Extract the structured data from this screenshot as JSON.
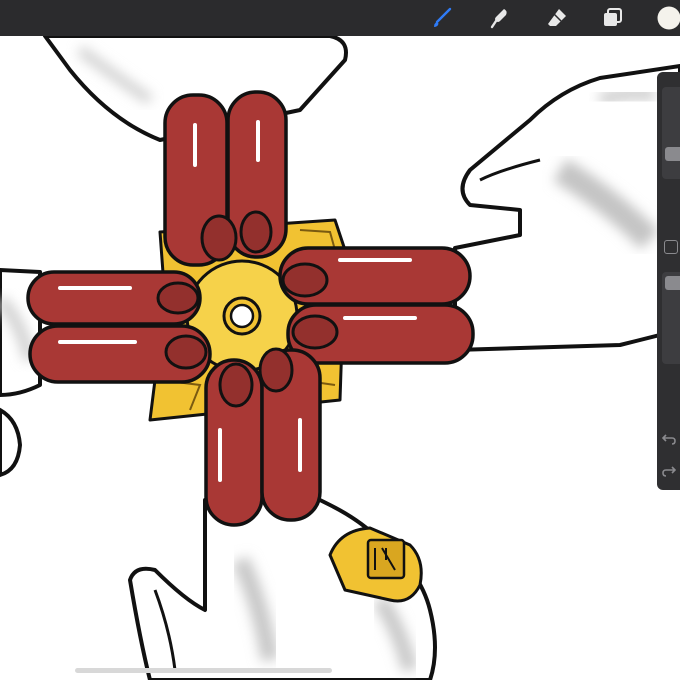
{
  "app": {
    "toolbar": {
      "tools": [
        {
          "name": "brush",
          "icon": "brush-icon",
          "active": true
        },
        {
          "name": "smudge",
          "icon": "smudge-icon",
          "active": false
        },
        {
          "name": "eraser",
          "icon": "eraser-icon",
          "active": false
        },
        {
          "name": "layers",
          "icon": "layers-icon",
          "active": false
        },
        {
          "name": "color",
          "icon": "color-swatch-icon",
          "active": false
        }
      ]
    },
    "sidebar": {
      "brush_size_level": 0.65,
      "opacity_level": 0.05,
      "icons": [
        "modify-button-icon",
        "undo-icon",
        "redo-icon"
      ]
    },
    "colors": {
      "topbar": "#2b2b2d",
      "active_tool": "#2f7bf6",
      "inactive_tool": "#e8e8e8",
      "current_color": "#f4f2ec",
      "finger_red": "#a93835",
      "gold": "#f1c232",
      "skin": "#ffffff",
      "shadow": "#c8c8c8"
    }
  }
}
